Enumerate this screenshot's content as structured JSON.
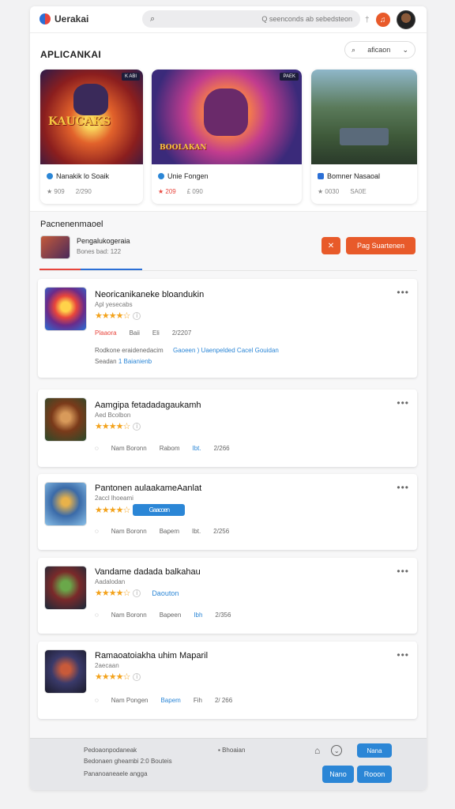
{
  "app": {
    "name": "Uerakai"
  },
  "search": {
    "placeholder": "Q seenconds ab sebedsteon"
  },
  "section": {
    "title": "APLICANKAI",
    "sort_label": "aficaon"
  },
  "featured": [
    {
      "art_text": "KAUCAKS",
      "badge": "K ABI",
      "name": "Nanakik lo Soaik",
      "rating": "★ 909",
      "count": "2/290"
    },
    {
      "art_text": "BOOLAKAN",
      "badge": "PAEK",
      "name": "Unie Fongen",
      "rating": "★ 209",
      "count": "£ 090"
    },
    {
      "art_text": "",
      "badge": "",
      "name": "Bomner Nasaoal",
      "rating": "★ 0030",
      "count": "SA0E"
    }
  ],
  "developer": {
    "section_title": "Pacnenenmaoel",
    "name": "Pengalukogeraia",
    "stats": "Bones bad: 122",
    "follow_label": "Pag Suartenen"
  },
  "apps": [
    {
      "title": "Neoricanikaneke bloandukin",
      "subtitle": "Apl yesecabs",
      "stars": "★★★★☆",
      "foot": [
        "Plaaora",
        "Baii",
        "Eli",
        "2/2207"
      ],
      "desc_left": "Rodkone eraidenedacim",
      "desc_right": "Gaoeen ) Uaenpelded Cacel Gouidan",
      "desc2_left": "Seadan",
      "desc2_right": "1 Baianienb"
    },
    {
      "title": "Aamgipa fetadadagaukamh",
      "subtitle": "Aed Bcolbon",
      "stars": "★★★★☆",
      "foot": [
        "Nam Boronn",
        "Rabom",
        "Ibt.",
        "2/266"
      ]
    },
    {
      "title": "Pantonen aulaakameAanlat",
      "subtitle": "2accl lhoeami",
      "stars": "★★★★☆",
      "badge": "Gaacoen",
      "foot": [
        "Nam Boronn",
        "Bapem",
        "Ibt.",
        "2/256"
      ]
    },
    {
      "title": "Vandame dadada balkahau",
      "subtitle": "Aadalodan",
      "stars": "★★★★☆",
      "extra": "Daouton",
      "foot": [
        "Nam Boronn",
        "Bapeen",
        "Ibh",
        "2/356"
      ]
    },
    {
      "title": "Ramaoatoiakha uhim Maparil",
      "subtitle": "2aecaan",
      "stars": "★★★★☆",
      "foot": [
        "Nam Pongen",
        "Bapem",
        "Fih",
        "2/ 266"
      ]
    }
  ],
  "footer": {
    "line1": "Pedoaonpodaneak",
    "line2": "Bedonaen gheambi 2:0 Bouteis",
    "line3": "Pananoaneaele angga",
    "mid": "Bhoaian",
    "badge": "Nana",
    "btn1": "Nano",
    "btn2": "Rooon"
  },
  "colors": {
    "accent": "#e85a2a",
    "blue": "#2b86d6",
    "star": "#f3a21b"
  }
}
